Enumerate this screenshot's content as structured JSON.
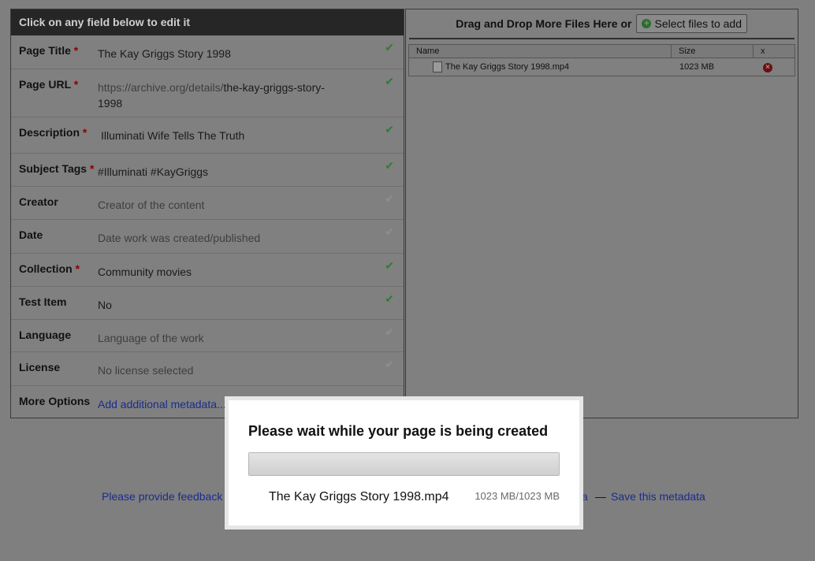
{
  "left_panel": {
    "header": "Click on any field below to edit it",
    "fields": [
      {
        "label": "Page Title",
        "required": "*",
        "value": "The Kay Griggs Story 1998",
        "check": "✔"
      },
      {
        "label": "Page URL",
        "required": "*",
        "url_prefix": "https://archive.org/details/",
        "value": "the-kay-griggs-story-1998",
        "check": "✔"
      },
      {
        "label": "Description",
        "required": "*",
        "value": "Illuminati Wife Tells The Truth",
        "check": "✔"
      },
      {
        "label": "Subject Tags",
        "required": "*",
        "value": "#Illuminati #KayGriggs",
        "check": "✔"
      },
      {
        "label": "Creator",
        "value": "Creator of the content",
        "check": "✔"
      },
      {
        "label": "Date",
        "value": "Date work was created/published",
        "check": "✔"
      },
      {
        "label": "Collection",
        "required": "*",
        "value": "Community movies",
        "check": "✔"
      },
      {
        "label": "Test Item",
        "value": "No",
        "check": "✔"
      },
      {
        "label": "Language",
        "value": "Language of the work",
        "check": "✔"
      },
      {
        "label": "License",
        "value": "No license selected",
        "check": "✔"
      },
      {
        "label": "More Options",
        "value": "Add additional metadata..."
      }
    ]
  },
  "right_panel": {
    "drop_text": "Drag and Drop More Files Here or",
    "select_button": "Select files to add",
    "table": {
      "columns": [
        "Name",
        "Size",
        "x"
      ],
      "rows": [
        {
          "name": "The Kay Griggs Story 1998.mp4",
          "size": "1023 MB"
        }
      ]
    }
  },
  "footer": {
    "feedback_link": "Please provide feedback",
    "tail_fragment": "a",
    "separator": "—",
    "save_link": "Save this metadata"
  },
  "modal": {
    "title": "Please wait while your page is being created",
    "progress_fraction": 1.0,
    "file_name": "The Kay Griggs Story 1998.mp4",
    "file_progress": "1023 MB/1023 MB"
  },
  "colors": {
    "check_done": "#2e7d32",
    "required_star": "#8a0000",
    "link": "#1a2b8e"
  }
}
